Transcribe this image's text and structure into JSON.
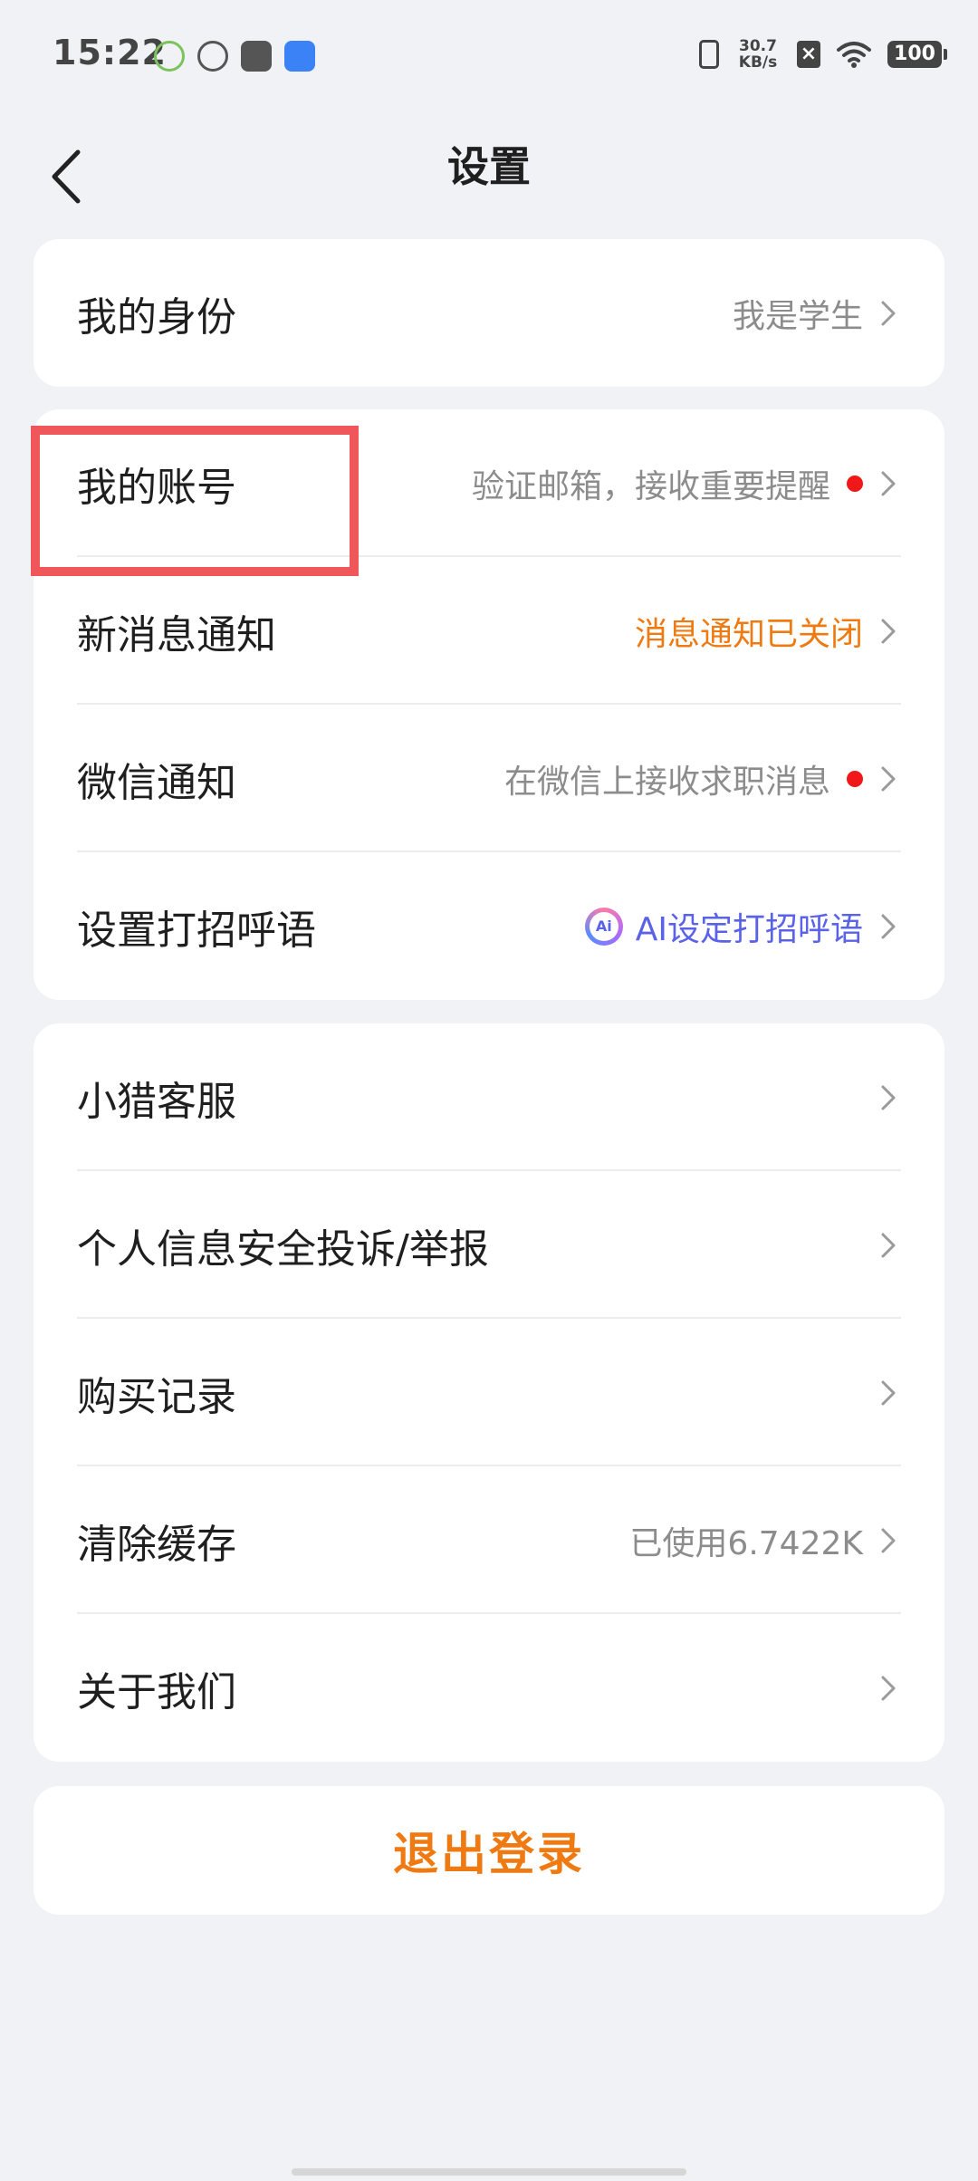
{
  "status_bar": {
    "time": "15:22",
    "net_speed_value": "30.7",
    "net_speed_unit": "KB/s",
    "battery": "100"
  },
  "header": {
    "title": "设置"
  },
  "card1": {
    "identity": {
      "label": "我的身份",
      "value": "我是学生"
    }
  },
  "card2": {
    "account": {
      "label": "我的账号",
      "value": "验证邮箱，接收重要提醒"
    },
    "new_message": {
      "label": "新消息通知",
      "value": "消息通知已关闭"
    },
    "wechat": {
      "label": "微信通知",
      "value": "在微信上接收求职消息"
    },
    "greeting": {
      "label": "设置打招呼语",
      "value": "AI设定打招呼语",
      "ai_badge": "Ai"
    }
  },
  "card3": {
    "service": {
      "label": "小猎客服"
    },
    "complaint": {
      "label": "个人信息安全投诉/举报"
    },
    "purchase": {
      "label": "购买记录"
    },
    "cache": {
      "label": "清除缓存",
      "value": "已使用6.7422K"
    },
    "about": {
      "label": "关于我们"
    }
  },
  "logout": {
    "label": "退出登录"
  },
  "colors": {
    "accent_orange": "#f07a12",
    "ai_purple": "#5a63e8",
    "dot_red": "#f01818",
    "highlight_red": "#f0575a"
  }
}
